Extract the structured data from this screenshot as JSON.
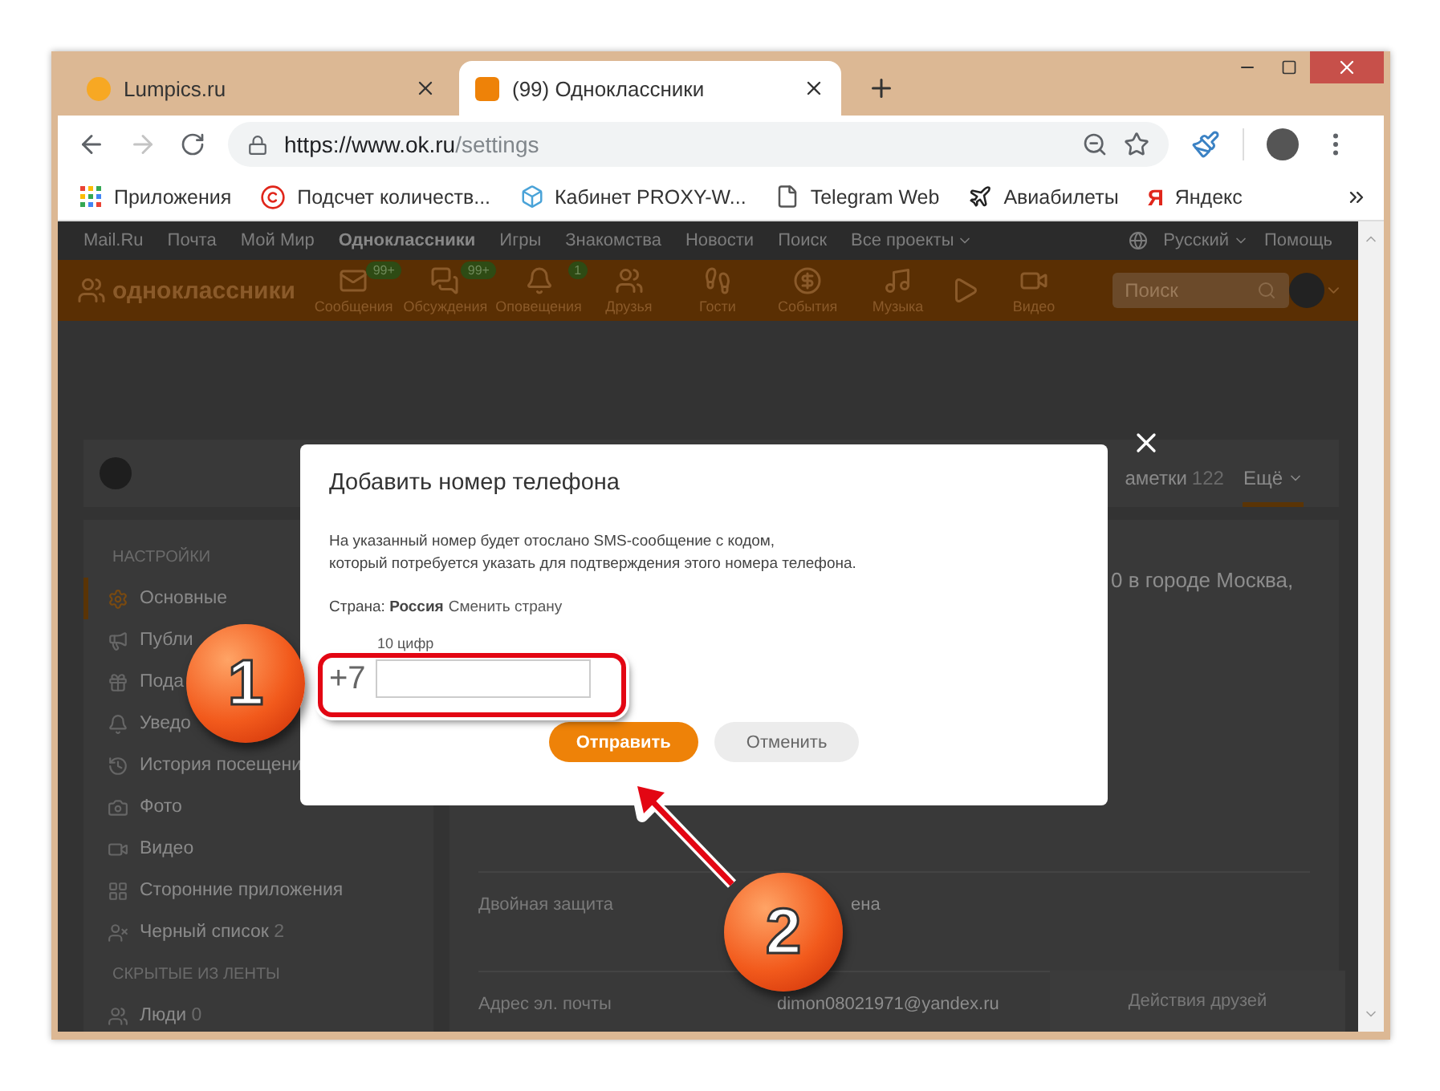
{
  "browser": {
    "tabs": [
      {
        "title": "Lumpics.ru",
        "selected": false
      },
      {
        "title": "(99) Одноклассники",
        "selected": true
      }
    ],
    "forward": {
      "disabled": true
    },
    "address": {
      "host": "https://www.ok.ru",
      "path": "/settings"
    },
    "bookmarks": [
      {
        "label": "Приложения"
      },
      {
        "label": "Подсчет количеств..."
      },
      {
        "label": "Кабинет PROXY-W..."
      },
      {
        "label": "Telegram Web"
      },
      {
        "label": "Авиабилеты"
      },
      {
        "label": "Яндекс",
        "glyph": "Я"
      }
    ]
  },
  "page": {
    "top_links": [
      {
        "label": "Mail.Ru",
        "selected": false
      },
      {
        "label": "Почта",
        "selected": false
      },
      {
        "label": "Мой Мир",
        "selected": false
      },
      {
        "label": "Одноклассники",
        "selected": true
      },
      {
        "label": "Игры",
        "selected": false
      },
      {
        "label": "Знакомства",
        "selected": false
      },
      {
        "label": "Новости",
        "selected": false
      },
      {
        "label": "Поиск",
        "selected": false
      },
      {
        "label": "Все проекты",
        "selected": false
      }
    ],
    "language": "Русский",
    "help": "Помощь",
    "logo": "одноклассники",
    "nav": [
      {
        "kind": "labeled",
        "label": "Сообщения",
        "badge": "99+"
      },
      {
        "kind": "labeled",
        "label": "Обсуждения",
        "badge": "99+"
      },
      {
        "kind": "labeled",
        "label": "Оповещения",
        "badge": "1"
      },
      {
        "kind": "labeled",
        "label": "Друзья"
      },
      {
        "kind": "labeled",
        "label": "Гости"
      },
      {
        "kind": "labeled",
        "label": "События"
      },
      {
        "kind": "labeled",
        "label": "Музыка"
      },
      {
        "kind": "icon"
      },
      {
        "kind": "labeled",
        "label": "Видео"
      }
    ],
    "search": {
      "placeholder": "Поиск"
    },
    "profile_tabs": [
      {
        "label": "аметки",
        "count": "122",
        "selected": false
      },
      {
        "label": "Ещё",
        "selected": true
      }
    ],
    "sidebar": [
      {
        "kind": "header",
        "label": "НАСТРОЙКИ"
      },
      {
        "kind": "item",
        "label": "Основные",
        "selected": true
      },
      {
        "kind": "item",
        "label": "Публи",
        "selected": false
      },
      {
        "kind": "item",
        "label": "Пода",
        "selected": false
      },
      {
        "kind": "item",
        "label": "Уведо",
        "selected": false
      },
      {
        "kind": "item",
        "label": "История посещени",
        "selected": false
      },
      {
        "kind": "item",
        "label": "Фото",
        "selected": false
      },
      {
        "kind": "item",
        "label": "Видео",
        "selected": false
      },
      {
        "kind": "item",
        "label": "Сторонние приложения",
        "selected": false
      },
      {
        "kind": "item",
        "label": "Черный список",
        "count": "2",
        "selected": false
      },
      {
        "kind": "header",
        "label": "СКРЫТЫЕ ИЗ ЛЕНТЫ"
      },
      {
        "kind": "item",
        "label": "Люди",
        "count": "0",
        "selected": false
      }
    ],
    "details": [
      {
        "value": "0 в городе Москва,"
      },
      {
        "label": "Двойная защита",
        "value": "ена"
      },
      {
        "label": "Адрес эл. почты",
        "value": "dimon08021971@yandex.ru"
      }
    ],
    "friends_panel": "Действия друзей"
  },
  "dialog": {
    "title": "Добавить номер телефона",
    "lines": [
      "На указанный номер будет отослано SMS-сообщение с кодом,",
      "который потребуется указать для подтверждения этого номера телефона."
    ],
    "country": "Страна: **Россия**",
    "change_link": "Сменить страну",
    "hint": "10 цифр",
    "prefix": "+7",
    "buttons": [
      {
        "kind": "primary",
        "label": "Отправить"
      },
      {
        "kind": "secondary",
        "label": "Отменить"
      }
    ]
  },
  "annotations": {
    "steps": [
      "1",
      "2"
    ]
  }
}
